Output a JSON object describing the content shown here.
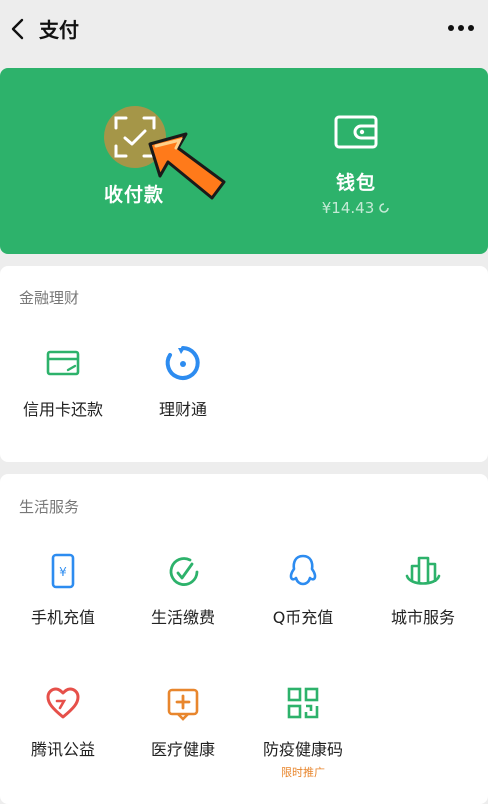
{
  "header": {
    "title": "支付",
    "back_icon": "chevron-left-icon",
    "more_icon": "more-dots-icon"
  },
  "wallet_card": {
    "background": "#2db26b",
    "pay": {
      "label": "收付款",
      "icon": "scan-pay-icon"
    },
    "wallet": {
      "label": "钱包",
      "balance": "¥14.43",
      "icon": "wallet-icon"
    },
    "pointer_icon": "pointing-arrow-icon"
  },
  "finance": {
    "title": "金融理财",
    "items": [
      {
        "label": "信用卡还款",
        "icon": "credit-card-icon",
        "color": "#2db26b"
      },
      {
        "label": "理财通",
        "icon": "wealth-icon",
        "color": "#2d8cf0"
      }
    ]
  },
  "life": {
    "title": "生活服务",
    "items": [
      {
        "label": "手机充值",
        "icon": "phone-topup-icon",
        "color": "#2d8cf0"
      },
      {
        "label": "生活缴费",
        "icon": "bill-payment-icon",
        "color": "#2db26b"
      },
      {
        "label": "Q币充值",
        "icon": "qq-coin-icon",
        "color": "#2d8cf0"
      },
      {
        "label": "城市服务",
        "icon": "city-service-icon",
        "color": "#2db26b"
      },
      {
        "label": "腾讯公益",
        "icon": "charity-heart-icon",
        "color": "#e6504a"
      },
      {
        "label": "医疗健康",
        "icon": "medical-icon",
        "color": "#e8862d"
      },
      {
        "label": "防疫健康码",
        "icon": "health-qr-icon",
        "color": "#2db26b",
        "sub": "限时推广"
      }
    ]
  }
}
